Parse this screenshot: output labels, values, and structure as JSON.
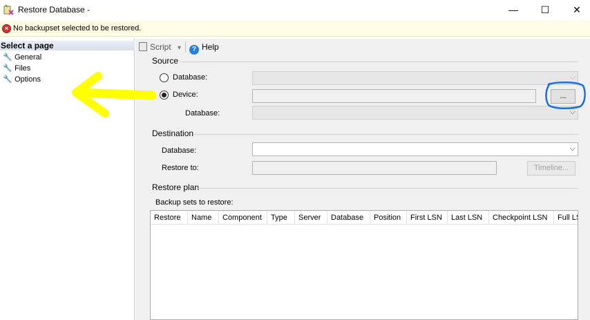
{
  "window": {
    "title": "Restore Database -",
    "minimize": "—",
    "maximize": "☐",
    "close": "✕"
  },
  "message": {
    "text": "No backupset selected to be restored."
  },
  "left_pane": {
    "header": "Select a page",
    "items": [
      {
        "label": "General"
      },
      {
        "label": "Files"
      },
      {
        "label": "Options"
      }
    ]
  },
  "toolbar": {
    "script_label": "Script",
    "script_arrow": "▾",
    "help_label": "Help"
  },
  "source": {
    "title": "Source",
    "database_radio_label": "Database:",
    "device_radio_label": "Device:",
    "device_database_label": "Database:",
    "browse_label": "...",
    "selected": "Device"
  },
  "destination": {
    "title": "Destination",
    "database_label": "Database:",
    "restore_to_label": "Restore to:",
    "timeline_label": "Timeline..."
  },
  "restore_plan": {
    "title": "Restore plan",
    "backup_sets_label": "Backup sets to restore:",
    "columns": [
      "Restore",
      "Name",
      "Component",
      "Type",
      "Server",
      "Database",
      "Position",
      "First LSN",
      "Last LSN",
      "Checkpoint LSN",
      "Full LS"
    ]
  },
  "annotations": {
    "arrow_color": "#ffff00",
    "circle_color": "#1a6fe0"
  }
}
